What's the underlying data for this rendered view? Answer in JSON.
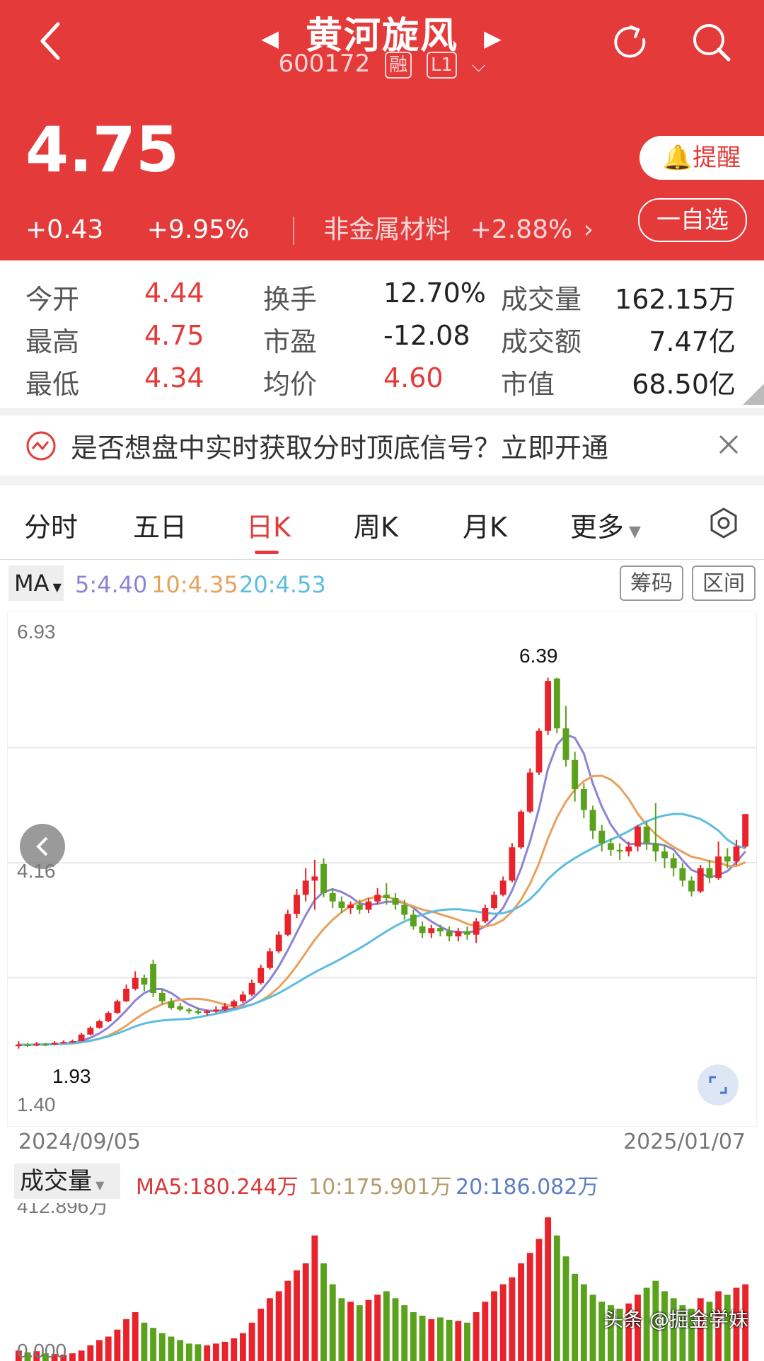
{
  "header": {
    "stock_name": "黄河旋风",
    "stock_code": "600172",
    "tag_margin": "融",
    "tag_level": "L1",
    "price": "4.75",
    "change": "+0.43",
    "change_pct": "+9.95%",
    "sector_name": "非金属材料",
    "sector_pct": "+2.88%",
    "remind_label": "提醒",
    "watchlist_label": "一自选",
    "bg_color": "#e43a3a"
  },
  "stats": [
    {
      "label": "今开",
      "value": "4.44",
      "red": true
    },
    {
      "label": "换手",
      "value": "12.70%",
      "red": false
    },
    {
      "label": "成交量",
      "value": "162.15万",
      "red": false
    },
    {
      "label": "最高",
      "value": "4.75",
      "red": true
    },
    {
      "label": "市盈",
      "value": "-12.08",
      "red": false
    },
    {
      "label": "成交额",
      "value": "7.47亿",
      "red": false
    },
    {
      "label": "最低",
      "value": "4.34",
      "red": true
    },
    {
      "label": "均价",
      "value": "4.60",
      "red": true
    },
    {
      "label": "市值",
      "value": "68.50亿",
      "red": false
    }
  ],
  "notice": {
    "text": "是否想盘中实时获取分时顶底信号？立即开通"
  },
  "tabs": [
    "分时",
    "五日",
    "日K",
    "周K",
    "月K",
    "更多"
  ],
  "active_tab": "日K",
  "ma": {
    "label": "MA",
    "ma5": "5:4.40",
    "ma10": "10:4.35",
    "ma20": "20:4.53",
    "chips_btn": "筹码",
    "range_btn": "区间",
    "colors": {
      "ma5": "#8b84d4",
      "ma10": "#e8a15c",
      "ma20": "#5bbde0",
      "up": "#e8232b",
      "down": "#5aa11c"
    }
  },
  "chart": {
    "y_top": "6.93",
    "y_mid": "4.16",
    "y_bottom": "1.40",
    "high_label": "6.39",
    "low_label": "1.93",
    "date_start": "2024/09/05",
    "date_end": "2025/01/07"
  },
  "volume": {
    "label": "成交量",
    "ma5": "MA5:180.244万",
    "ma10": "10:175.901万",
    "ma20": "20:186.082万",
    "max": "412.896万",
    "min": "0.000"
  },
  "watermark": "头条 @掘金学妹",
  "chart_data": {
    "type": "candlestick",
    "x_range": [
      "2024/09/05",
      "2025/01/07"
    ],
    "ylim": [
      1.4,
      6.93
    ],
    "high": 6.39,
    "low": 1.93,
    "candles": [
      [
        1.96,
        1.98,
        2.02,
        1.93
      ],
      [
        1.98,
        1.97,
        2.0,
        1.95
      ],
      [
        1.97,
        1.99,
        2.01,
        1.96
      ],
      [
        1.99,
        1.98,
        2.0,
        1.96
      ],
      [
        1.98,
        2.0,
        2.02,
        1.97
      ],
      [
        2.0,
        2.01,
        2.03,
        1.99
      ],
      [
        2.01,
        2.02,
        2.04,
        2.0
      ],
      [
        2.02,
        2.1,
        2.12,
        2.02
      ],
      [
        2.1,
        2.18,
        2.2,
        2.09
      ],
      [
        2.18,
        2.26,
        2.28,
        2.17
      ],
      [
        2.26,
        2.36,
        2.38,
        2.25
      ],
      [
        2.36,
        2.5,
        2.52,
        2.35
      ],
      [
        2.5,
        2.65,
        2.7,
        2.49
      ],
      [
        2.65,
        2.78,
        2.86,
        2.63
      ],
      [
        2.78,
        2.7,
        2.82,
        2.62
      ],
      [
        2.95,
        2.6,
        3.0,
        2.55
      ],
      [
        2.6,
        2.5,
        2.64,
        2.46
      ],
      [
        2.5,
        2.42,
        2.54,
        2.4
      ],
      [
        2.44,
        2.4,
        2.48,
        2.38
      ],
      [
        2.4,
        2.38,
        2.42,
        2.35
      ],
      [
        2.38,
        2.36,
        2.42,
        2.34
      ],
      [
        2.36,
        2.38,
        2.4,
        2.33
      ],
      [
        2.38,
        2.4,
        2.44,
        2.36
      ],
      [
        2.4,
        2.44,
        2.48,
        2.38
      ],
      [
        2.44,
        2.5,
        2.52,
        2.42
      ],
      [
        2.5,
        2.58,
        2.62,
        2.48
      ],
      [
        2.58,
        2.72,
        2.76,
        2.56
      ],
      [
        2.72,
        2.9,
        2.94,
        2.7
      ],
      [
        2.9,
        3.1,
        3.14,
        2.88
      ],
      [
        3.1,
        3.3,
        3.34,
        3.08
      ],
      [
        3.3,
        3.55,
        3.6,
        3.28
      ],
      [
        3.55,
        3.78,
        3.85,
        3.5
      ],
      [
        3.78,
        3.95,
        4.1,
        3.7
      ],
      [
        3.95,
        4.0,
        4.2,
        3.6
      ],
      [
        4.15,
        3.8,
        4.22,
        3.75
      ],
      [
        3.8,
        3.7,
        3.86,
        3.62
      ],
      [
        3.7,
        3.62,
        3.76,
        3.56
      ],
      [
        3.62,
        3.66,
        3.7,
        3.55
      ],
      [
        3.66,
        3.6,
        3.72,
        3.55
      ],
      [
        3.6,
        3.7,
        3.74,
        3.56
      ],
      [
        3.7,
        3.78,
        3.86,
        3.66
      ],
      [
        3.78,
        3.74,
        3.92,
        3.66
      ],
      [
        3.74,
        3.66,
        3.8,
        3.6
      ],
      [
        3.66,
        3.54,
        3.72,
        3.48
      ],
      [
        3.54,
        3.4,
        3.6,
        3.36
      ],
      [
        3.4,
        3.32,
        3.46,
        3.26
      ],
      [
        3.32,
        3.38,
        3.42,
        3.26
      ],
      [
        3.38,
        3.34,
        3.42,
        3.28
      ],
      [
        3.34,
        3.28,
        3.4,
        3.22
      ],
      [
        3.28,
        3.34,
        3.38,
        3.22
      ],
      [
        3.34,
        3.3,
        3.4,
        3.24
      ],
      [
        3.3,
        3.46,
        3.5,
        3.2
      ],
      [
        3.46,
        3.62,
        3.66,
        3.44
      ],
      [
        3.62,
        3.78,
        3.82,
        3.6
      ],
      [
        3.78,
        3.95,
        4.0,
        3.76
      ],
      [
        3.95,
        4.35,
        4.4,
        3.93
      ],
      [
        4.35,
        4.78,
        4.8,
        4.33
      ],
      [
        4.78,
        5.25,
        5.3,
        4.76
      ],
      [
        5.25,
        5.75,
        5.78,
        5.22
      ],
      [
        5.75,
        6.35,
        6.39,
        5.7
      ],
      [
        6.38,
        5.78,
        6.39,
        5.72
      ],
      [
        5.78,
        5.4,
        6.05,
        5.32
      ],
      [
        5.4,
        5.05,
        5.5,
        4.9
      ],
      [
        5.05,
        4.8,
        5.12,
        4.7
      ],
      [
        4.8,
        4.55,
        4.85,
        4.45
      ],
      [
        4.55,
        4.4,
        4.62,
        4.3
      ],
      [
        4.4,
        4.32,
        4.46,
        4.25
      ],
      [
        4.32,
        4.3,
        4.4,
        4.2
      ],
      [
        4.3,
        4.36,
        4.42,
        4.24
      ],
      [
        4.36,
        4.6,
        4.62,
        4.3
      ],
      [
        4.6,
        4.4,
        4.66,
        4.32
      ],
      [
        4.4,
        4.3,
        4.88,
        4.18
      ],
      [
        4.3,
        4.22,
        4.38,
        4.1
      ],
      [
        4.22,
        4.1,
        4.28,
        4.0
      ],
      [
        4.1,
        3.95,
        4.16,
        3.88
      ],
      [
        3.95,
        3.82,
        4.0,
        3.76
      ],
      [
        3.82,
        4.1,
        4.14,
        3.8
      ],
      [
        4.1,
        3.98,
        4.2,
        3.92
      ],
      [
        3.98,
        4.24,
        4.42,
        3.96
      ],
      [
        4.24,
        4.18,
        4.34,
        4.1
      ],
      [
        4.18,
        4.36,
        4.44,
        4.14
      ],
      [
        4.36,
        4.75,
        4.75,
        4.34
      ]
    ],
    "volume": [
      30,
      25,
      28,
      22,
      20,
      18,
      22,
      30,
      45,
      60,
      70,
      90,
      120,
      140,
      110,
      95,
      80,
      70,
      60,
      50,
      48,
      45,
      50,
      55,
      65,
      80,
      110,
      150,
      180,
      200,
      230,
      260,
      280,
      360,
      280,
      220,
      180,
      170,
      160,
      175,
      190,
      200,
      180,
      160,
      140,
      130,
      120,
      125,
      118,
      115,
      110,
      140,
      170,
      200,
      220,
      240,
      280,
      310,
      350,
      412,
      360,
      300,
      250,
      220,
      190,
      170,
      160,
      150,
      165,
      190,
      210,
      230,
      200,
      180,
      160,
      150,
      180,
      170,
      200,
      190,
      210,
      220
    ]
  }
}
